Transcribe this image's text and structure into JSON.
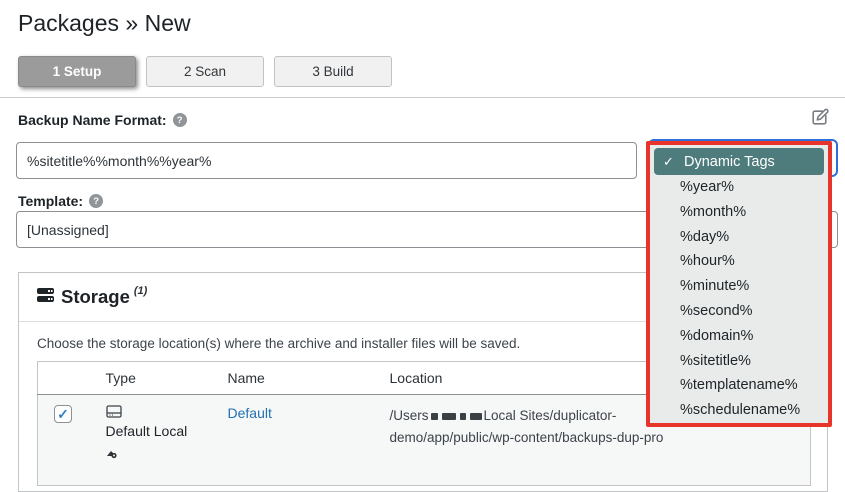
{
  "page": {
    "title": "Packages » New"
  },
  "tabs": [
    {
      "label": "1 Setup",
      "active": true
    },
    {
      "label": "2 Scan",
      "active": false
    },
    {
      "label": "3 Build",
      "active": false
    }
  ],
  "form": {
    "backup_name_label": "Backup Name Format:",
    "backup_name_value": "%sitetitle%%month%%year%",
    "template_label": "Template:",
    "template_value": "[Unassigned]"
  },
  "icons": {
    "help_glyph": "?",
    "check_glyph": "✓"
  },
  "dynamic_tags": {
    "selected_label": "Dynamic Tags",
    "options": [
      "%year%",
      "%month%",
      "%day%",
      "%hour%",
      "%minute%",
      "%second%",
      "%domain%",
      "%sitetitle%",
      "%templatename%",
      "%schedulename%"
    ],
    "highlight_border_color": "#e8352c",
    "selected_bg_color": "#4e7c7d"
  },
  "storage": {
    "title": "Storage",
    "count": "(1)",
    "description": "Choose the storage location(s) where the archive and installer files will be saved.",
    "table": {
      "headers": {
        "type": "Type",
        "name": "Name",
        "location": "Location"
      },
      "row": {
        "checked": true,
        "type_label": "Default Local",
        "name_label": "Default",
        "location_prefix": "/Users",
        "location_line1_tail": "Local Sites/duplicator-",
        "location_line2": "demo/app/public/wp-content/backups-dup-pro",
        "redacted_block_widths": [
          7,
          14,
          6,
          12
        ]
      }
    }
  }
}
